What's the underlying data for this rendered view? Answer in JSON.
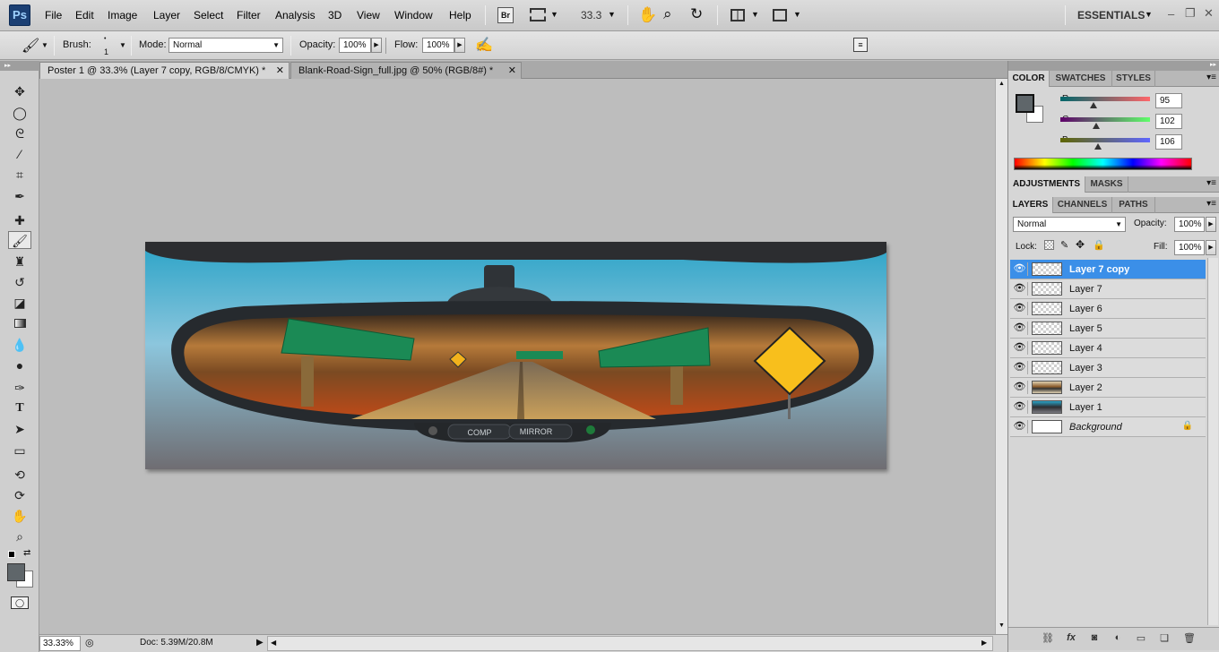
{
  "menubar": {
    "logo": "Ps",
    "items": [
      "File",
      "Edit",
      "Image",
      "Layer",
      "Select",
      "Filter",
      "Analysis",
      "3D",
      "View",
      "Window",
      "Help"
    ],
    "bridge_label": "Br",
    "zoom_value": "33.3",
    "workspace": "ESSENTIALS"
  },
  "options": {
    "brush_label": "Brush:",
    "brush_size": "1",
    "mode_label": "Mode:",
    "mode_value": "Normal",
    "opacity_label": "Opacity:",
    "opacity_value": "100%",
    "flow_label": "Flow:",
    "flow_value": "100%"
  },
  "tabs": [
    {
      "label": "Poster 1 @ 33.3% (Layer 7 copy, RGB/8/CMYK) *",
      "active": true
    },
    {
      "label": "Blank-Road-Sign_full.jpg @ 50% (RGB/8#) *",
      "active": false
    }
  ],
  "status": {
    "zoom": "33.33%",
    "doc": "Doc: 5.39M/20.8M"
  },
  "poster": {
    "comp_label": "COMP",
    "mirror_label": "MIRROR"
  },
  "color_panel": {
    "tabs": [
      "COLOR",
      "SWATCHES",
      "STYLES"
    ],
    "r_label": "R",
    "g_label": "G",
    "b_label": "B",
    "r": "95",
    "g": "102",
    "b": "106",
    "r_fraction": 0.37,
    "g_fraction": 0.4,
    "b_fraction": 0.42,
    "foreground": "#5f666a"
  },
  "adjust_panel": {
    "tabs": [
      "ADJUSTMENTS",
      "MASKS"
    ]
  },
  "layers_panel": {
    "tabs": [
      "LAYERS",
      "CHANNELS",
      "PATHS"
    ],
    "blend_mode": "Normal",
    "opacity_label": "Opacity:",
    "opacity_value": "100%",
    "lock_label": "Lock:",
    "fill_label": "Fill:",
    "fill_value": "100%",
    "layers": [
      {
        "name": "Layer 7 copy",
        "selected": true
      },
      {
        "name": "Layer 7"
      },
      {
        "name": "Layer 6"
      },
      {
        "name": "Layer 5"
      },
      {
        "name": "Layer 4"
      },
      {
        "name": "Layer 3"
      },
      {
        "name": "Layer 2"
      },
      {
        "name": "Layer 1"
      },
      {
        "name": "Background"
      }
    ]
  }
}
